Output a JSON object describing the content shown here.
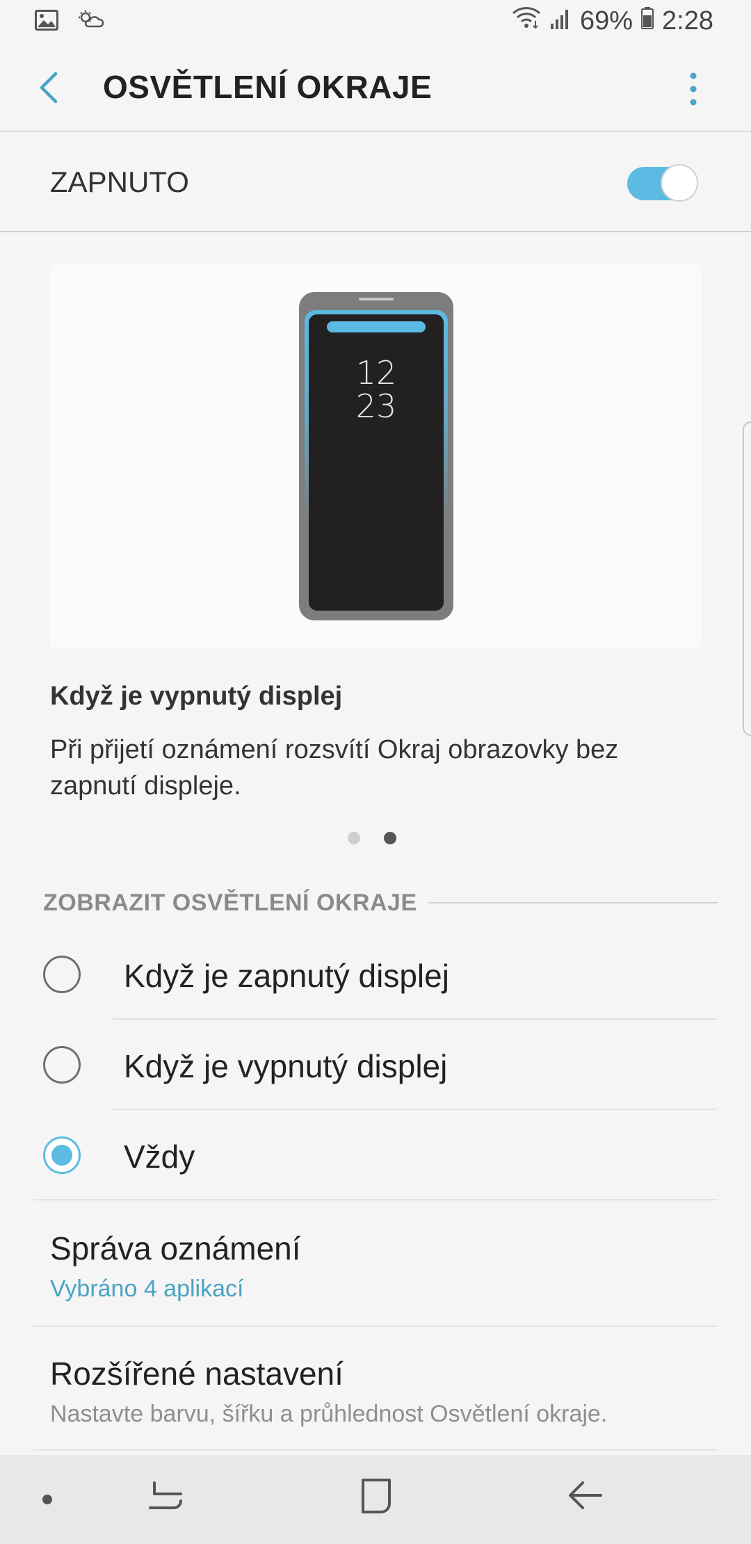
{
  "status_bar": {
    "battery": "69%",
    "time": "2:28",
    "icons": [
      "gallery-icon",
      "weather-icon",
      "wifi-icon",
      "signal-icon",
      "battery-icon"
    ]
  },
  "header": {
    "title": "OSVĚTLENÍ OKRAJE",
    "back_icon": "back-arrow-icon",
    "more_icon": "more-vert-icon"
  },
  "master_switch": {
    "label": "ZAPNUTO",
    "state": "on"
  },
  "preview": {
    "clock_hour": "12",
    "clock_minute": "23",
    "title": "Když je vypnutý displej",
    "description": "Při přijetí oznámení rozsvítí Okraj obrazovky bez zapnutí displeje.",
    "page_count": 2,
    "active_page": 2
  },
  "display_section": {
    "header": "ZOBRAZIT OSVĚTLENÍ OKRAJE",
    "options": [
      {
        "label": "Když je zapnutý displej",
        "selected": false
      },
      {
        "label": "Když je vypnutý displej",
        "selected": false
      },
      {
        "label": "Vždy",
        "selected": true
      }
    ]
  },
  "settings": [
    {
      "title": "Správa oznámení",
      "subtitle": "Vybráno 4 aplikací"
    },
    {
      "title": "Rozšířené nastavení",
      "subtitle": "Nastavte barvu, šířku a průhlednost Osvětlení okraje."
    }
  ],
  "nav_bar": {
    "items": [
      "dot-icon",
      "recents-icon",
      "home-icon",
      "back-icon"
    ]
  },
  "colors": {
    "accent": "#5bbbe2",
    "link": "#4aa3c4",
    "background": "#f5f5f5",
    "nav_background": "#e8e8e8"
  }
}
